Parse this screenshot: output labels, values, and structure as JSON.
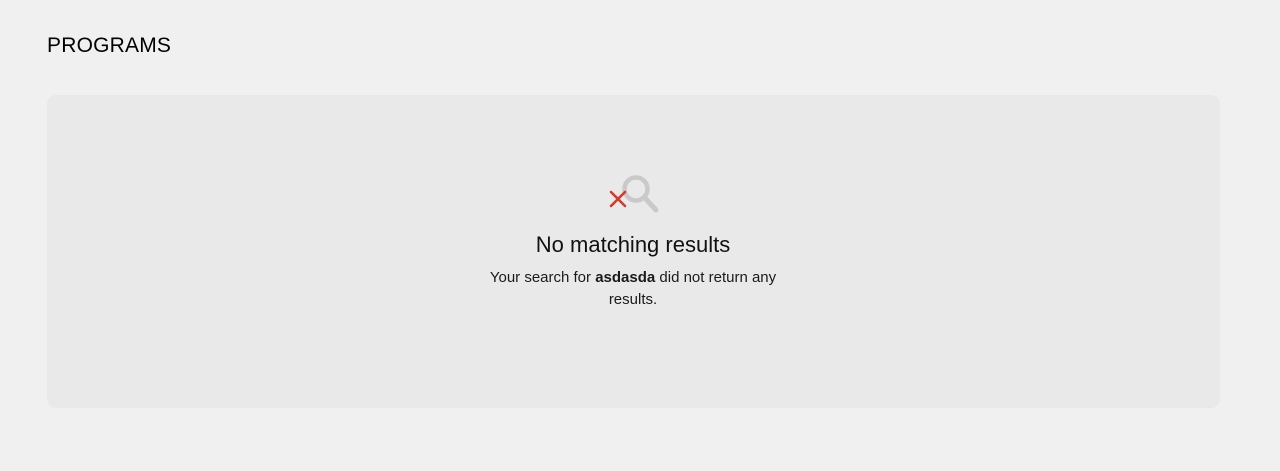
{
  "page": {
    "title": "PROGRAMS"
  },
  "empty_state": {
    "icon": "search-no-results-icon",
    "title": "No matching results",
    "message_prefix": "Your search for ",
    "search_term": "asdasda",
    "message_suffix": " did not return any results."
  },
  "colors": {
    "background": "#f0f0f0",
    "panel": "#e9e9e9",
    "icon_gray": "#c9c9c9",
    "icon_red": "#d8392b"
  }
}
